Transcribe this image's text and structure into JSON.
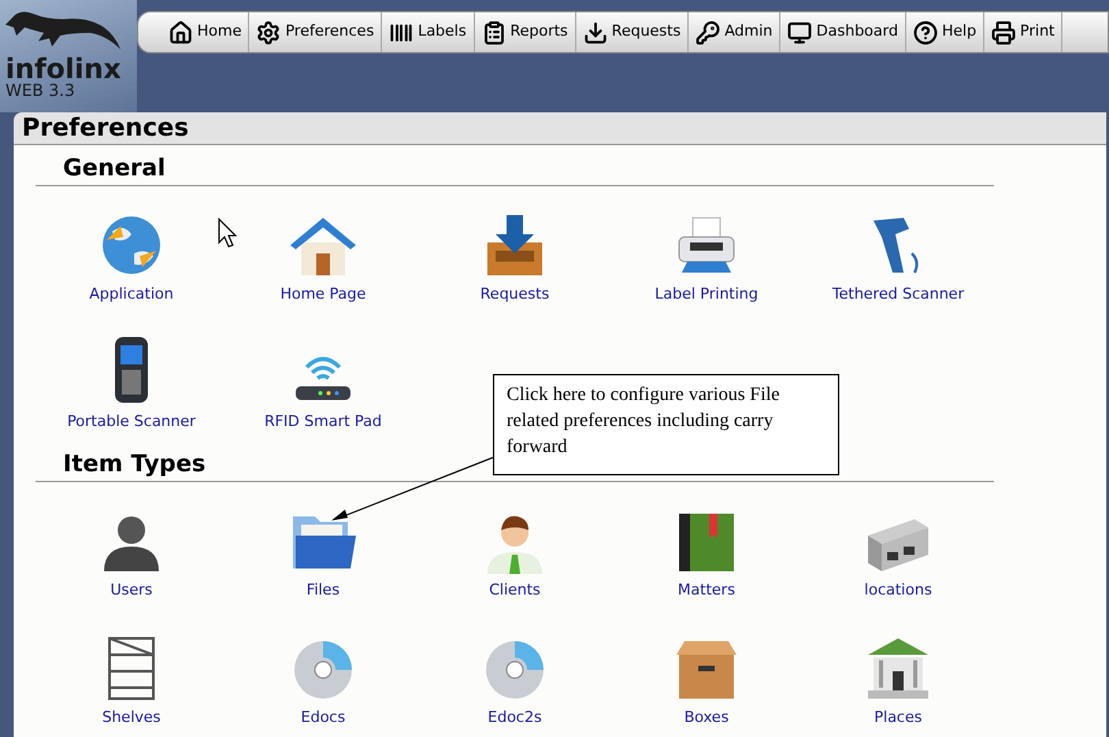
{
  "logo": {
    "name": "infolinx",
    "version": "WEB 3.3"
  },
  "nav": [
    {
      "label": "Home"
    },
    {
      "label": "Preferences"
    },
    {
      "label": "Labels"
    },
    {
      "label": "Reports"
    },
    {
      "label": "Requests"
    },
    {
      "label": "Admin"
    },
    {
      "label": "Dashboard"
    },
    {
      "label": "Help"
    },
    {
      "label": "Print"
    }
  ],
  "page_title": "Preferences",
  "sections": [
    {
      "heading": "General",
      "items": [
        {
          "label": "Application"
        },
        {
          "label": "Home Page"
        },
        {
          "label": "Requests"
        },
        {
          "label": "Label Printing"
        },
        {
          "label": "Tethered Scanner"
        },
        {
          "label": "Portable Scanner"
        },
        {
          "label": "RFID Smart Pad"
        }
      ]
    },
    {
      "heading": "Item Types",
      "items": [
        {
          "label": "Users"
        },
        {
          "label": "Files"
        },
        {
          "label": "Clients"
        },
        {
          "label": "Matters"
        },
        {
          "label": "locations"
        },
        {
          "label": "Shelves"
        },
        {
          "label": "Edocs"
        },
        {
          "label": "Edoc2s"
        },
        {
          "label": "Boxes"
        },
        {
          "label": "Places"
        }
      ]
    }
  ],
  "callout": {
    "text": "Click here to configure various File related preferences including carry forward"
  }
}
